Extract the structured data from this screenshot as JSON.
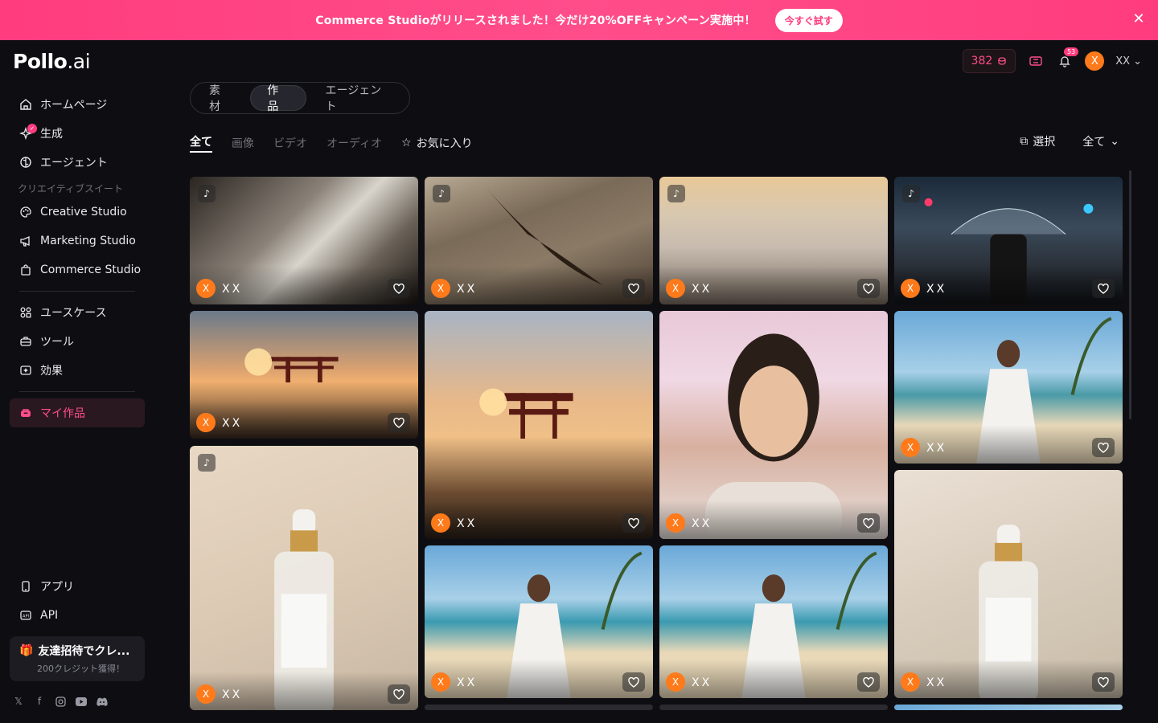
{
  "banner": {
    "text": "Commerce Studioがリリースされました！今だけ20%OFFキャンペーン実施中！",
    "button": "今すぐ試す"
  },
  "logo": {
    "main": "Pollo",
    "suffix": ".ai"
  },
  "header": {
    "credits": "382",
    "notifications": "53",
    "avatar_letter": "X",
    "user_name": "XX"
  },
  "sidebar": {
    "items": [
      {
        "label": "ホームページ"
      },
      {
        "label": "生成"
      },
      {
        "label": "エージェント"
      }
    ],
    "section_label": "クリエイティブスイート",
    "studios": [
      {
        "label": "Creative Studio"
      },
      {
        "label": "Marketing Studio"
      },
      {
        "label": "Commerce Studio"
      }
    ],
    "more": [
      {
        "label": "ユースケース"
      },
      {
        "label": "ツール"
      },
      {
        "label": "効果"
      }
    ],
    "active": "マイ作品",
    "bottom": [
      {
        "label": "アプリ"
      },
      {
        "label": "API"
      }
    ],
    "invite_title": "友達招待でクレ...",
    "invite_sub": "200クレジット獲得！"
  },
  "segment": [
    "素材",
    "作品",
    "エージェント"
  ],
  "filters": [
    "全て",
    "画像",
    "ビデオ",
    "オーディオ"
  ],
  "favorites": "お気に入り",
  "select_label": "選択",
  "sort_label": "全て",
  "card": {
    "avatar": "X",
    "name": "XX"
  },
  "colors": {
    "accent": "#ff3c7e",
    "avatar": "#ff7a1a",
    "bg": "#0e0e12"
  }
}
